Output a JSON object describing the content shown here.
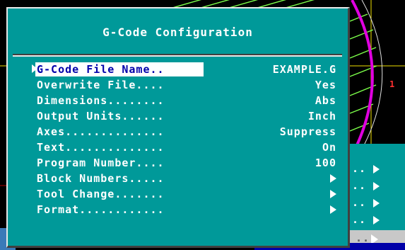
{
  "dialog": {
    "title": "G-Code Configuration",
    "selected_index": 0,
    "items": [
      {
        "label": "G-Code File Name..",
        "value": "EXAMPLE.G",
        "submenu": false
      },
      {
        "label": "Overwrite File....",
        "value": "Yes",
        "submenu": false
      },
      {
        "label": "Dimensions........",
        "value": "Abs",
        "submenu": false
      },
      {
        "label": "Output Units......",
        "value": "Inch",
        "submenu": false
      },
      {
        "label": "Axes..............",
        "value": "Suppress",
        "submenu": false
      },
      {
        "label": "Text..............",
        "value": "On",
        "submenu": false
      },
      {
        "label": "Program Number....",
        "value": "100",
        "submenu": false
      },
      {
        "label": "Block Numbers.....",
        "value": "",
        "submenu": true
      },
      {
        "label": "Tool Change.......",
        "value": "",
        "submenu": true
      },
      {
        "label": "Format............",
        "value": "",
        "submenu": true
      }
    ]
  },
  "background_menu": {
    "items": [
      "..",
      "..",
      "..",
      ".."
    ],
    "highlighted_label": ".."
  },
  "canvas": {
    "marker_label": "1"
  },
  "colors": {
    "dialog_bg": "#009999",
    "selection_bg": "#ffffff",
    "selection_text": "#0000aa",
    "arc_magenta": "#e000e0",
    "hatch_green": "#7cff4a",
    "guide_yellow": "#f0e000"
  }
}
